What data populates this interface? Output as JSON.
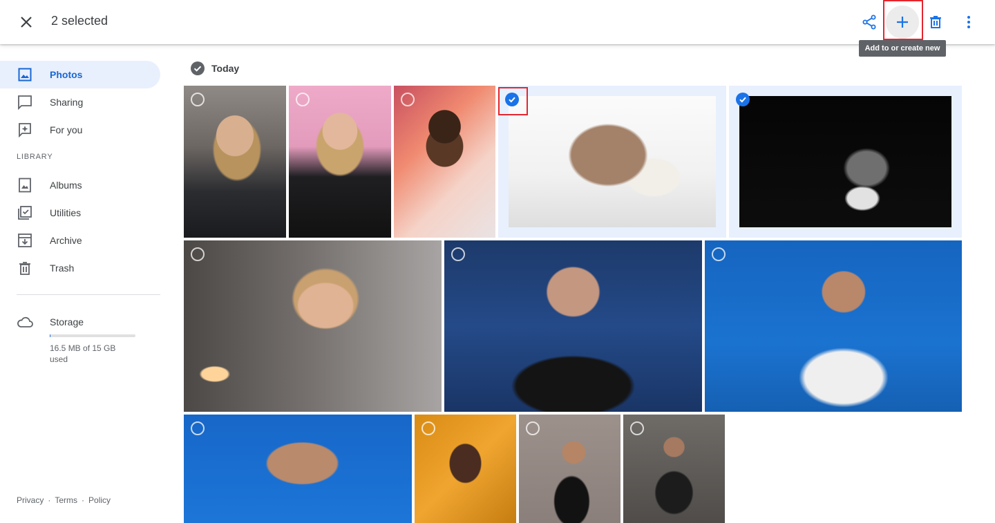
{
  "topbar": {
    "close_icon": "close-icon",
    "selection_count": "2 selected",
    "actions": [
      {
        "name": "share",
        "icon": "share-icon"
      },
      {
        "name": "add",
        "icon": "plus-icon"
      },
      {
        "name": "delete",
        "icon": "trash-icon"
      },
      {
        "name": "more",
        "icon": "more-vertical-icon"
      }
    ],
    "tooltip": "Add to or create new"
  },
  "sidebar": {
    "items": [
      {
        "label": "Photos",
        "icon": "photo-icon",
        "active": true
      },
      {
        "label": "Sharing",
        "icon": "chat-icon"
      },
      {
        "label": "For you",
        "icon": "sparkle-icon"
      }
    ],
    "library_heading": "LIBRARY",
    "library_items": [
      {
        "label": "Albums",
        "icon": "album-icon"
      },
      {
        "label": "Utilities",
        "icon": "utilities-icon"
      },
      {
        "label": "Archive",
        "icon": "archive-icon"
      },
      {
        "label": "Trash",
        "icon": "trash-icon"
      }
    ],
    "storage": {
      "label": "Storage",
      "usage": "16.5 MB of 15 GB used",
      "used_fraction": 0.001
    },
    "footer": [
      "Privacy",
      "Terms",
      "Policy"
    ],
    "footer_separator": "·"
  },
  "main": {
    "date_heading": "Today",
    "photos": [
      {
        "subject": "woman in leather jacket sitting",
        "selected": false
      },
      {
        "subject": "woman in leather jacket against pink wall",
        "selected": false
      },
      {
        "subject": "woman with glasses on colorful background",
        "selected": false
      },
      {
        "subject": "french bulldog lying down",
        "selected": true
      },
      {
        "subject": "black and white cat",
        "selected": true
      },
      {
        "subject": "woman near candles",
        "selected": false
      },
      {
        "subject": "smiling older man in suit",
        "selected": false
      },
      {
        "subject": "surprised man with beard",
        "selected": false
      },
      {
        "subject": "smiling man on blue background",
        "selected": false
      },
      {
        "subject": "woman on orange background",
        "selected": false
      },
      {
        "subject": "man in bomber jacket against brick wall",
        "selected": false
      },
      {
        "subject": "man sitting in black outfit",
        "selected": false
      }
    ]
  },
  "colors": {
    "accent": "#1a73e8",
    "active_nav_bg": "#e8f0fe",
    "highlight_box": "#e3262e",
    "tooltip_bg": "#5f6368"
  }
}
